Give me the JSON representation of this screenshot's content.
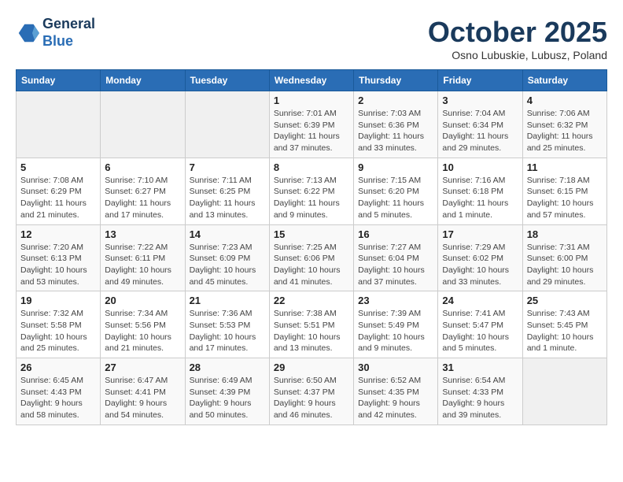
{
  "header": {
    "logo_line1": "General",
    "logo_line2": "Blue",
    "month": "October 2025",
    "location": "Osno Lubuskie, Lubusz, Poland"
  },
  "days_of_week": [
    "Sunday",
    "Monday",
    "Tuesday",
    "Wednesday",
    "Thursday",
    "Friday",
    "Saturday"
  ],
  "weeks": [
    [
      {
        "day": "",
        "info": ""
      },
      {
        "day": "",
        "info": ""
      },
      {
        "day": "",
        "info": ""
      },
      {
        "day": "1",
        "info": "Sunrise: 7:01 AM\nSunset: 6:39 PM\nDaylight: 11 hours\nand 37 minutes."
      },
      {
        "day": "2",
        "info": "Sunrise: 7:03 AM\nSunset: 6:36 PM\nDaylight: 11 hours\nand 33 minutes."
      },
      {
        "day": "3",
        "info": "Sunrise: 7:04 AM\nSunset: 6:34 PM\nDaylight: 11 hours\nand 29 minutes."
      },
      {
        "day": "4",
        "info": "Sunrise: 7:06 AM\nSunset: 6:32 PM\nDaylight: 11 hours\nand 25 minutes."
      }
    ],
    [
      {
        "day": "5",
        "info": "Sunrise: 7:08 AM\nSunset: 6:29 PM\nDaylight: 11 hours\nand 21 minutes."
      },
      {
        "day": "6",
        "info": "Sunrise: 7:10 AM\nSunset: 6:27 PM\nDaylight: 11 hours\nand 17 minutes."
      },
      {
        "day": "7",
        "info": "Sunrise: 7:11 AM\nSunset: 6:25 PM\nDaylight: 11 hours\nand 13 minutes."
      },
      {
        "day": "8",
        "info": "Sunrise: 7:13 AM\nSunset: 6:22 PM\nDaylight: 11 hours\nand 9 minutes."
      },
      {
        "day": "9",
        "info": "Sunrise: 7:15 AM\nSunset: 6:20 PM\nDaylight: 11 hours\nand 5 minutes."
      },
      {
        "day": "10",
        "info": "Sunrise: 7:16 AM\nSunset: 6:18 PM\nDaylight: 11 hours\nand 1 minute."
      },
      {
        "day": "11",
        "info": "Sunrise: 7:18 AM\nSunset: 6:15 PM\nDaylight: 10 hours\nand 57 minutes."
      }
    ],
    [
      {
        "day": "12",
        "info": "Sunrise: 7:20 AM\nSunset: 6:13 PM\nDaylight: 10 hours\nand 53 minutes."
      },
      {
        "day": "13",
        "info": "Sunrise: 7:22 AM\nSunset: 6:11 PM\nDaylight: 10 hours\nand 49 minutes."
      },
      {
        "day": "14",
        "info": "Sunrise: 7:23 AM\nSunset: 6:09 PM\nDaylight: 10 hours\nand 45 minutes."
      },
      {
        "day": "15",
        "info": "Sunrise: 7:25 AM\nSunset: 6:06 PM\nDaylight: 10 hours\nand 41 minutes."
      },
      {
        "day": "16",
        "info": "Sunrise: 7:27 AM\nSunset: 6:04 PM\nDaylight: 10 hours\nand 37 minutes."
      },
      {
        "day": "17",
        "info": "Sunrise: 7:29 AM\nSunset: 6:02 PM\nDaylight: 10 hours\nand 33 minutes."
      },
      {
        "day": "18",
        "info": "Sunrise: 7:31 AM\nSunset: 6:00 PM\nDaylight: 10 hours\nand 29 minutes."
      }
    ],
    [
      {
        "day": "19",
        "info": "Sunrise: 7:32 AM\nSunset: 5:58 PM\nDaylight: 10 hours\nand 25 minutes."
      },
      {
        "day": "20",
        "info": "Sunrise: 7:34 AM\nSunset: 5:56 PM\nDaylight: 10 hours\nand 21 minutes."
      },
      {
        "day": "21",
        "info": "Sunrise: 7:36 AM\nSunset: 5:53 PM\nDaylight: 10 hours\nand 17 minutes."
      },
      {
        "day": "22",
        "info": "Sunrise: 7:38 AM\nSunset: 5:51 PM\nDaylight: 10 hours\nand 13 minutes."
      },
      {
        "day": "23",
        "info": "Sunrise: 7:39 AM\nSunset: 5:49 PM\nDaylight: 10 hours\nand 9 minutes."
      },
      {
        "day": "24",
        "info": "Sunrise: 7:41 AM\nSunset: 5:47 PM\nDaylight: 10 hours\nand 5 minutes."
      },
      {
        "day": "25",
        "info": "Sunrise: 7:43 AM\nSunset: 5:45 PM\nDaylight: 10 hours\nand 1 minute."
      }
    ],
    [
      {
        "day": "26",
        "info": "Sunrise: 6:45 AM\nSunset: 4:43 PM\nDaylight: 9 hours\nand 58 minutes."
      },
      {
        "day": "27",
        "info": "Sunrise: 6:47 AM\nSunset: 4:41 PM\nDaylight: 9 hours\nand 54 minutes."
      },
      {
        "day": "28",
        "info": "Sunrise: 6:49 AM\nSunset: 4:39 PM\nDaylight: 9 hours\nand 50 minutes."
      },
      {
        "day": "29",
        "info": "Sunrise: 6:50 AM\nSunset: 4:37 PM\nDaylight: 9 hours\nand 46 minutes."
      },
      {
        "day": "30",
        "info": "Sunrise: 6:52 AM\nSunset: 4:35 PM\nDaylight: 9 hours\nand 42 minutes."
      },
      {
        "day": "31",
        "info": "Sunrise: 6:54 AM\nSunset: 4:33 PM\nDaylight: 9 hours\nand 39 minutes."
      },
      {
        "day": "",
        "info": ""
      }
    ]
  ]
}
